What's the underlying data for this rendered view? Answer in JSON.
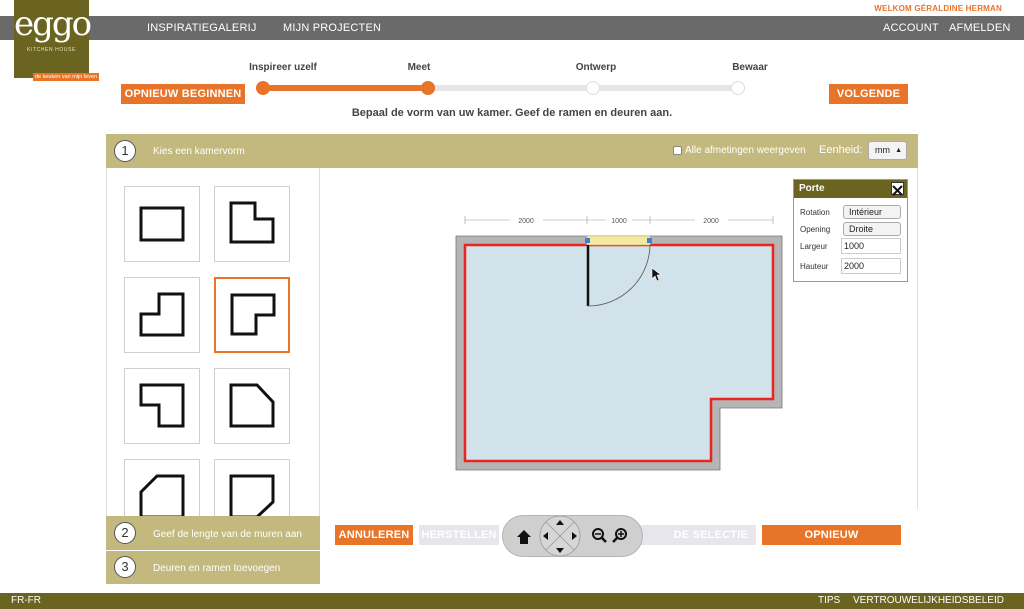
{
  "header": {
    "welcome": "WELKOM GÉRALDINE HERMAN",
    "nav": {
      "gallery": "INSPIRATIEGALERIJ",
      "projects": "MIJN PROJECTEN",
      "account": "ACCOUNT",
      "logout": "AFMELDEN"
    },
    "logo": {
      "brand": "eggo",
      "subtitle": "KITCHEN HOUSE",
      "tagline": "de keuken van mijn leven"
    }
  },
  "progress": {
    "restart": "OPNIEUW BEGINNEN",
    "next": "VOLGENDE",
    "steps": [
      "Inspireer uzelf",
      "Meet",
      "Ontwerp",
      "Bewaar"
    ],
    "current_step": 2,
    "instruction": "Bepaal de vorm van uw kamer. Geef de ramen en deuren aan."
  },
  "panel": {
    "step1_num": "1",
    "step1_title": "Kies een kamervorm",
    "show_dims_label": "Alle afmetingen weergeven",
    "unit_label": "Eenheid:",
    "unit_value": "mm",
    "step2_num": "2",
    "step2_title": "Geef de lengte van de muren aan",
    "step3_num": "3",
    "step3_title": "Deuren en ramen toevoegen",
    "shapes": [
      "rectangle",
      "l-shape-notch-top-right",
      "l-shape-notch-top-left",
      "l-shape-notch-bottom-right",
      "l-shape-notch-bottom-left",
      "cut-corner-top-right",
      "cut-corner-top-left",
      "cut-corner-bottom-right"
    ],
    "selected_shape": 3
  },
  "canvas": {
    "dims": [
      "2000",
      "1000",
      "2000"
    ]
  },
  "props": {
    "title": "Porte",
    "rows": [
      {
        "label": "Rotation",
        "value": "Intérieur"
      },
      {
        "label": "Opening",
        "value": "Droite"
      },
      {
        "label": "Largeur",
        "value": "1000"
      },
      {
        "label": "Hauteur",
        "value": "2000"
      }
    ]
  },
  "toolbar": {
    "cancel": "ANNULEREN",
    "restore": "HERSTELLEN",
    "clear": "DE SELECTIE WISSEN",
    "reset": "OPNIEUW INITIALISEREN"
  },
  "footer": {
    "locale": "FR-FR",
    "tips": "TIPS",
    "privacy": "VERTROUWELIJKHEIDSBELEID"
  },
  "colors": {
    "accent": "#e8742a",
    "olive": "#6b6421",
    "sand": "#c3b97e",
    "wall": "#e8251f",
    "floor": "#d2e2ea"
  }
}
